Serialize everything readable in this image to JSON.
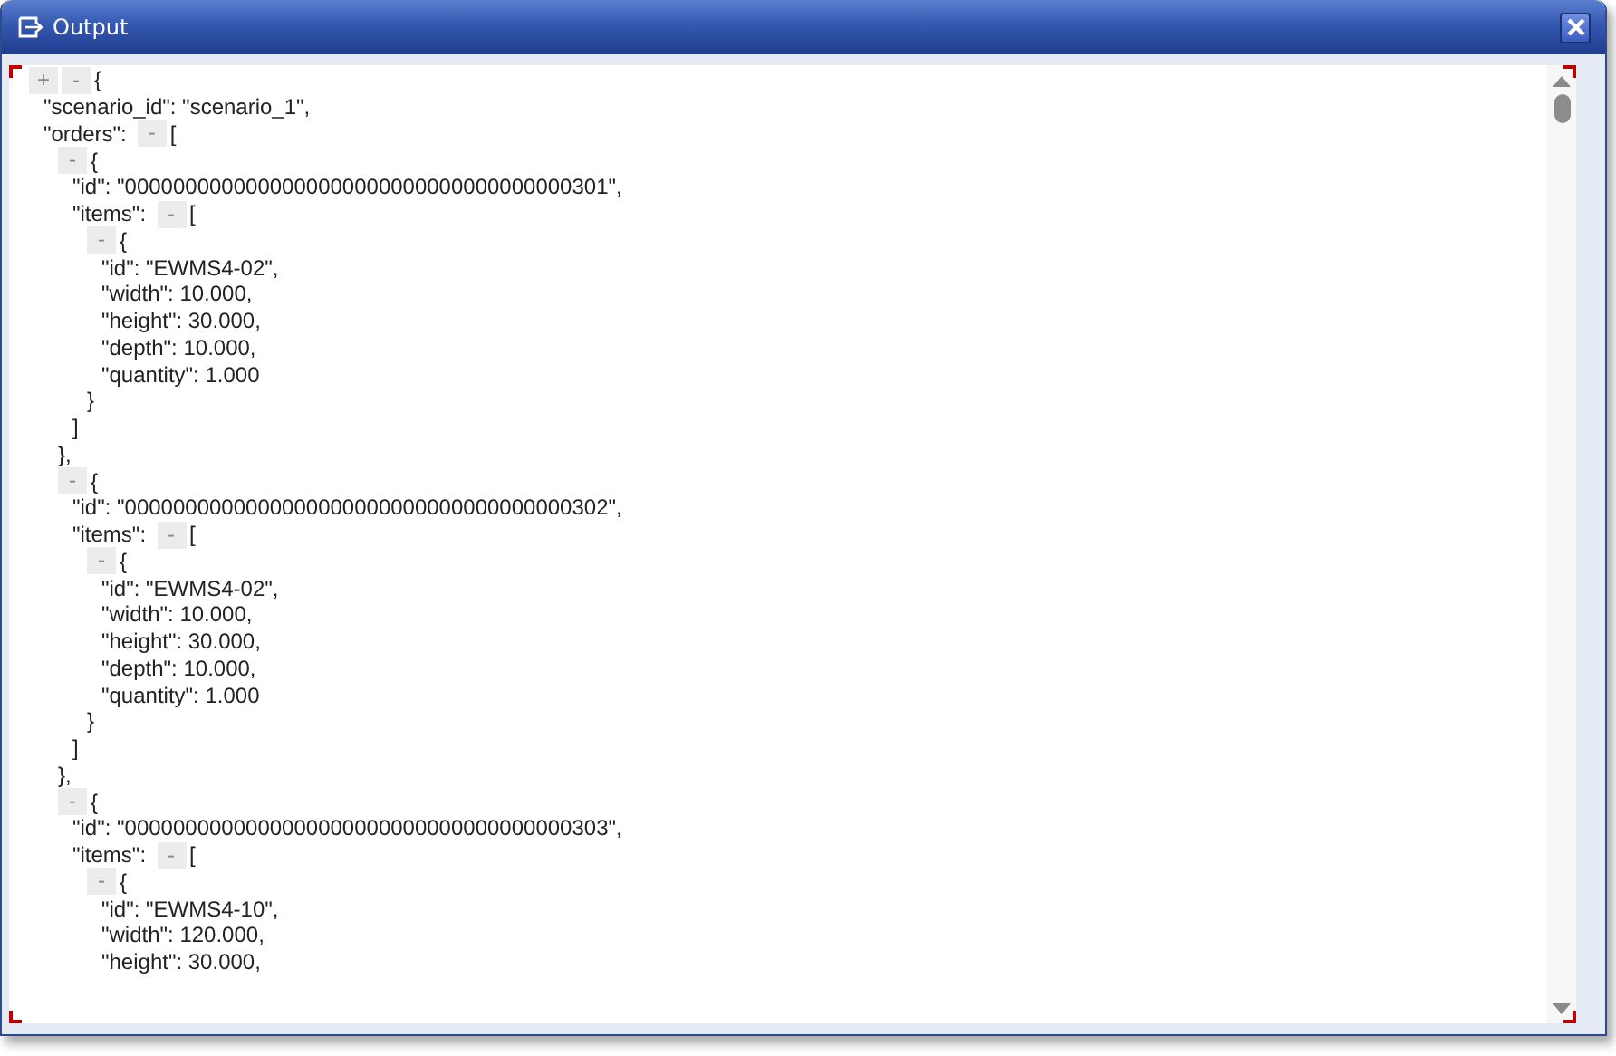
{
  "window": {
    "title": "Output"
  },
  "tree": {
    "toggles": [
      {
        "symbol": "+"
      },
      {
        "symbol": "-"
      }
    ],
    "open": "{",
    "children": [
      {
        "text": "\"scenario_id\": \"scenario_1\","
      },
      {
        "key": "\"orders\":",
        "toggles": [
          {
            "symbol": "-"
          }
        ],
        "open": "[",
        "children": [
          {
            "toggles": [
              {
                "symbol": "-"
              }
            ],
            "open": "{",
            "children": [
              {
                "text": "\"id\": \"0000000000000000000000000000000000000301\","
              },
              {
                "key": "\"items\":",
                "toggles": [
                  {
                    "symbol": "-"
                  }
                ],
                "open": "[",
                "children": [
                  {
                    "toggles": [
                      {
                        "symbol": "-"
                      }
                    ],
                    "open": "{",
                    "children": [
                      {
                        "text": "\"id\": \"EWMS4-02\","
                      },
                      {
                        "text": "\"width\": 10.000,"
                      },
                      {
                        "text": "\"height\": 30.000,"
                      },
                      {
                        "text": "\"depth\": 10.000,"
                      },
                      {
                        "text": "\"quantity\": 1.000"
                      }
                    ],
                    "close": "}"
                  }
                ],
                "close": "]"
              }
            ],
            "close": "},"
          },
          {
            "toggles": [
              {
                "symbol": "-"
              }
            ],
            "open": "{",
            "children": [
              {
                "text": "\"id\": \"0000000000000000000000000000000000000302\","
              },
              {
                "key": "\"items\":",
                "toggles": [
                  {
                    "symbol": "-"
                  }
                ],
                "open": "[",
                "children": [
                  {
                    "toggles": [
                      {
                        "symbol": "-"
                      }
                    ],
                    "open": "{",
                    "children": [
                      {
                        "text": "\"id\": \"EWMS4-02\","
                      },
                      {
                        "text": "\"width\": 10.000,"
                      },
                      {
                        "text": "\"height\": 30.000,"
                      },
                      {
                        "text": "\"depth\": 10.000,"
                      },
                      {
                        "text": "\"quantity\": 1.000"
                      }
                    ],
                    "close": "}"
                  }
                ],
                "close": "]"
              }
            ],
            "close": "},"
          },
          {
            "toggles": [
              {
                "symbol": "-"
              }
            ],
            "open": "{",
            "children": [
              {
                "text": "\"id\": \"0000000000000000000000000000000000000303\","
              },
              {
                "key": "\"items\":",
                "toggles": [
                  {
                    "symbol": "-"
                  }
                ],
                "open": "[",
                "children": [
                  {
                    "toggles": [
                      {
                        "symbol": "-"
                      }
                    ],
                    "open": "{",
                    "children": [
                      {
                        "text": "\"id\": \"EWMS4-10\","
                      },
                      {
                        "text": "\"width\": 120.000,"
                      },
                      {
                        "text": "\"height\": 30.000,"
                      }
                    ]
                  }
                ]
              }
            ]
          }
        ]
      }
    ]
  }
}
